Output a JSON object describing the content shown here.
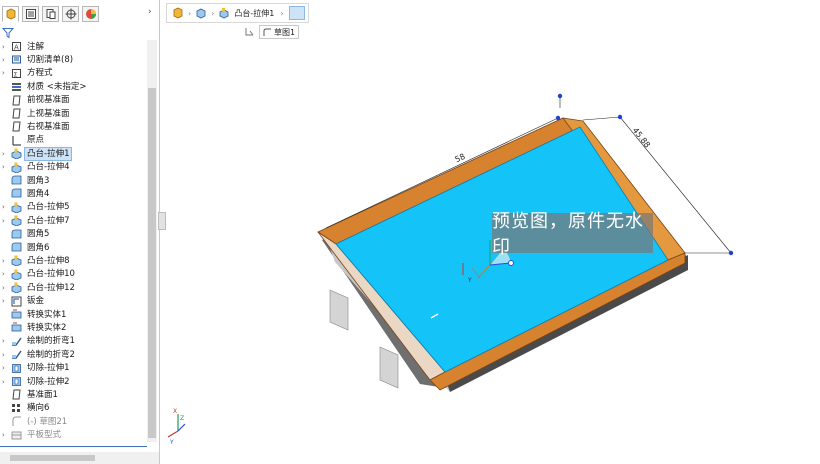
{
  "panel": {
    "tabs": [
      "feature-manager",
      "property-manager",
      "configuration-manager",
      "dimxpert-manager",
      "display-manager"
    ],
    "expand_icon": "chevron-right-icon",
    "filter_icon": "filter-icon"
  },
  "tree": [
    {
      "label": "注解",
      "arrow": true,
      "icon": "annotation-icon"
    },
    {
      "label": "切割清单(8)",
      "arrow": true,
      "icon": "cutlist-icon"
    },
    {
      "label": "方程式",
      "arrow": true,
      "icon": "equation-icon"
    },
    {
      "label": "材质 <未指定>",
      "arrow": false,
      "icon": "material-icon"
    },
    {
      "label": "前视基准面",
      "arrow": false,
      "icon": "plane-icon"
    },
    {
      "label": "上视基准面",
      "arrow": false,
      "icon": "plane-icon"
    },
    {
      "label": "右视基准面",
      "arrow": false,
      "icon": "plane-icon"
    },
    {
      "label": "原点",
      "arrow": false,
      "icon": "origin-icon"
    },
    {
      "label": "凸台-拉伸1",
      "arrow": true,
      "icon": "extrude-icon",
      "selected": true
    },
    {
      "label": "凸台-拉伸4",
      "arrow": true,
      "icon": "extrude-icon"
    },
    {
      "label": "圆角3",
      "arrow": false,
      "icon": "fillet-icon"
    },
    {
      "label": "圆角4",
      "arrow": false,
      "icon": "fillet-icon"
    },
    {
      "label": "凸台-拉伸5",
      "arrow": true,
      "icon": "extrude-icon"
    },
    {
      "label": "凸台-拉伸7",
      "arrow": true,
      "icon": "extrude-icon"
    },
    {
      "label": "圆角5",
      "arrow": false,
      "icon": "fillet-icon"
    },
    {
      "label": "圆角6",
      "arrow": false,
      "icon": "fillet-icon"
    },
    {
      "label": "凸台-拉伸8",
      "arrow": true,
      "icon": "extrude-icon"
    },
    {
      "label": "凸台-拉伸10",
      "arrow": true,
      "icon": "extrude-icon"
    },
    {
      "label": "凸台-拉伸12",
      "arrow": true,
      "icon": "extrude-icon"
    },
    {
      "label": "钣金",
      "arrow": true,
      "icon": "sheetmetal-icon"
    },
    {
      "label": "转换实体1",
      "arrow": false,
      "icon": "convert-icon"
    },
    {
      "label": "转换实体2",
      "arrow": false,
      "icon": "convert-icon"
    },
    {
      "label": "绘制的折弯1",
      "arrow": true,
      "icon": "bend-icon"
    },
    {
      "label": "绘制的折弯2",
      "arrow": true,
      "icon": "bend-icon"
    },
    {
      "label": "切除-拉伸1",
      "arrow": true,
      "icon": "cut-icon"
    },
    {
      "label": "切除-拉伸2",
      "arrow": true,
      "icon": "cut-icon"
    },
    {
      "label": "基准面1",
      "arrow": false,
      "icon": "plane-icon"
    },
    {
      "label": "横向6",
      "arrow": false,
      "icon": "pattern-icon"
    },
    {
      "label": "(-) 草图21",
      "arrow": false,
      "icon": "sketch-icon",
      "dim": true
    },
    {
      "label": "平板型式",
      "arrow": true,
      "icon": "flat-pattern-icon",
      "dim": true
    }
  ],
  "breadcrumb": {
    "label": "凸台-拉伸1",
    "icons": [
      "part-icon",
      "solid-body-icon",
      "extrude-icon"
    ]
  },
  "sketch_pill": {
    "label": "草图1"
  },
  "dimensions": {
    "length": "58",
    "width": "45.88"
  },
  "axis_labels": {
    "x": "X",
    "y": "Y",
    "z": "Z"
  },
  "watermark": "预览图，原件无水印",
  "colors": {
    "face": "#14c3f7",
    "wood": "#d6822f",
    "selection": "#cfe3f7"
  }
}
